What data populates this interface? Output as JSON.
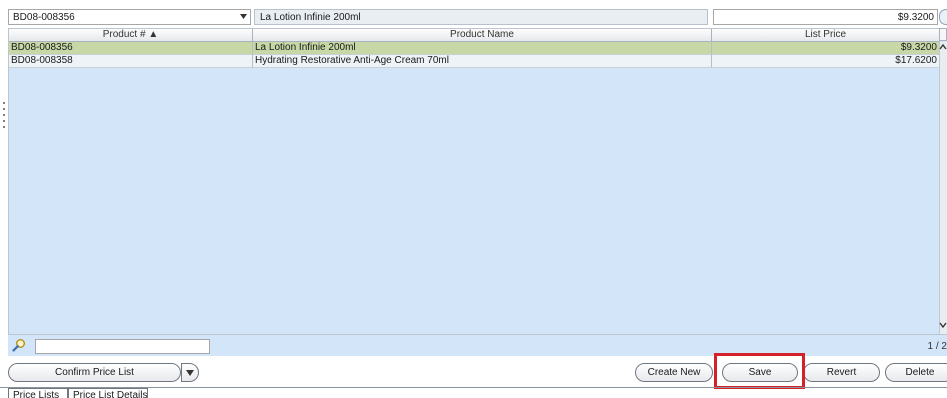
{
  "editor": {
    "product_value": "BD08-008356",
    "product_name_value": "La Lotion Infinie 200ml",
    "list_price_value": "$9.3200"
  },
  "grid": {
    "headers": [
      "Product # ▲",
      "Product Name",
      "List Price"
    ],
    "rows": [
      {
        "product": "BD08-008356",
        "name": "La Lotion Infinie 200ml",
        "price": "$9.3200"
      },
      {
        "product": "BD08-008358",
        "name": "Hydrating Restorative Anti-Age Cream 70ml",
        "price": "$17.6200"
      }
    ]
  },
  "find": {
    "value": "",
    "pager": "1 / 2"
  },
  "buttons": {
    "confirm": "Confirm Price List",
    "create_new": "Create New",
    "save": "Save",
    "revert": "Revert",
    "delete": "Delete"
  },
  "tabs": [
    "Price Lists",
    "Price List Details"
  ],
  "colors": {
    "grid_bg": "#d3e5f8",
    "selected_row": "#c7d8a6",
    "highlight_box": "#d3222a"
  }
}
